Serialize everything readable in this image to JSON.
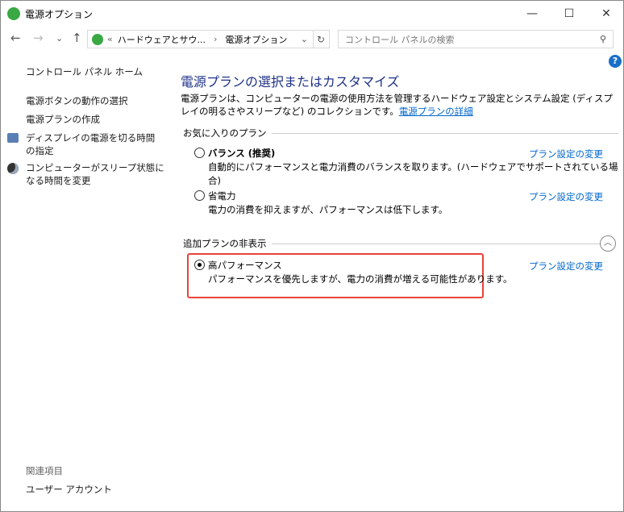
{
  "window": {
    "title": "電源オプション",
    "minimize": "—",
    "maximize": "☐",
    "close": "✕"
  },
  "nav": {
    "back": "←",
    "forward": "→",
    "recent": "⌄",
    "up": "↑",
    "refresh": "↻"
  },
  "address": {
    "prefix": "«",
    "crumbs": [
      "ハードウェアとサウ...",
      "電源オプション"
    ],
    "sep": "›",
    "dropdown": "⌄"
  },
  "search": {
    "placeholder": "コントロール パネルの検索"
  },
  "help": "?",
  "sidebar": {
    "home": "コントロール パネル ホーム",
    "items": [
      "電源ボタンの動作の選択",
      "電源プランの作成",
      "ディスプレイの電源を切る時間の指定",
      "コンピューターがスリープ状態になる時間を変更"
    ],
    "related_title": "関連項目",
    "related": [
      "ユーザー アカウント"
    ]
  },
  "main": {
    "title": "電源プランの選択またはカスタマイズ",
    "description": "電源プランは、コンピューターの電源の使用方法を管理するハードウェア設定とシステム設定 (ディスプレイの明るさやスリープなど) のコレクションです。",
    "details_link": "電源プランの詳細",
    "favorites_label": "お気に入りのプラン",
    "hidden_label": "追加プランの非表示",
    "plans": [
      {
        "name": "バランス (推奨)",
        "desc": "自動的にパフォーマンスと電力消費のバランスを取ります。(ハードウェアでサポートされている場合)",
        "change": "プラン設定の変更",
        "selected": false
      },
      {
        "name": "省電力",
        "desc": "電力の消費を抑えますが、パフォーマンスは低下します。",
        "change": "プラン設定の変更",
        "selected": false
      },
      {
        "name": "高パフォーマンス",
        "desc": "パフォーマンスを優先しますが、電力の消費が増える可能性があります。",
        "change": "プラン設定の変更",
        "selected": true
      }
    ]
  },
  "colors": {
    "highlight": "#e8443a",
    "link": "#0066cc",
    "title": "#1e3287"
  }
}
